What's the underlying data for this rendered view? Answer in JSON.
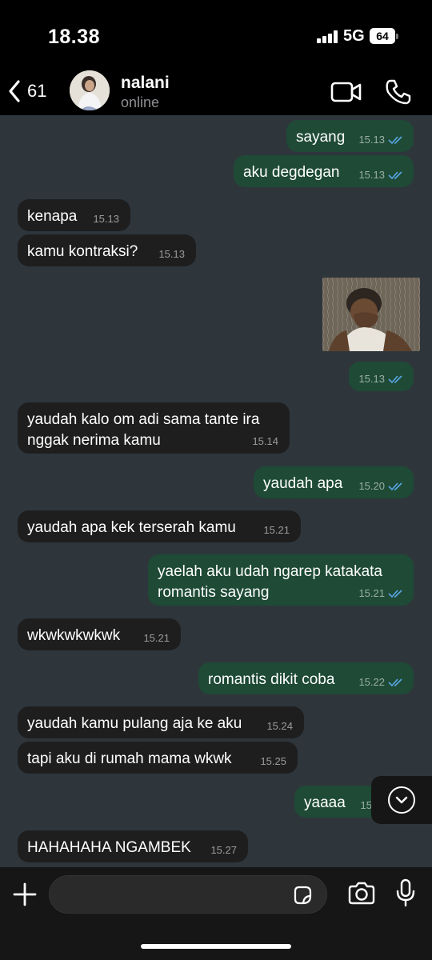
{
  "status_bar": {
    "time": "18.38",
    "network": "5G",
    "battery": "64"
  },
  "header": {
    "back_count": "61",
    "contact_name": "nalani",
    "contact_status": "online"
  },
  "messages": [
    {
      "dir": "out",
      "text": "sayang",
      "time": "15.13"
    },
    {
      "dir": "out",
      "text": "aku degdegan",
      "time": "15.13"
    },
    {
      "dir": "in",
      "text": "kenapa",
      "time": "15.13"
    },
    {
      "dir": "in",
      "text": "kamu kontraksi?",
      "time": "15.13"
    },
    {
      "dir": "out",
      "text": "",
      "time": "15.13"
    },
    {
      "dir": "in",
      "text": "yaudah kalo om adi sama tante ira\nnggak nerima kamu",
      "time": "15.14"
    },
    {
      "dir": "out",
      "text": "yaudah apa",
      "time": "15.20"
    },
    {
      "dir": "in",
      "text": "yaudah apa kek terserah kamu",
      "time": "15.21"
    },
    {
      "dir": "out",
      "text": "yaelah aku udah ngarep katakata\nromantis sayang",
      "time": "15.21"
    },
    {
      "dir": "in",
      "text": "wkwkwkwkwk",
      "time": "15.21"
    },
    {
      "dir": "out",
      "text": "romantis dikit coba",
      "time": "15.22"
    },
    {
      "dir": "in",
      "text": "yaudah kamu pulang aja ke aku",
      "time": "15.24"
    },
    {
      "dir": "in",
      "text": "tapi aku di rumah mama wkwk",
      "time": "15.25"
    },
    {
      "dir": "out",
      "text": "yaaaa",
      "time": "15"
    },
    {
      "dir": "in",
      "text": "HAHAHAHA NGAMBEK",
      "time": "15.27"
    }
  ],
  "input": {
    "placeholder": ""
  },
  "colors": {
    "chat_bg": "#2e363c",
    "incoming_bubble": "#1e1e1f",
    "outgoing_bubble": "#1e4a36",
    "tick_blue": "#5aa7e8"
  }
}
